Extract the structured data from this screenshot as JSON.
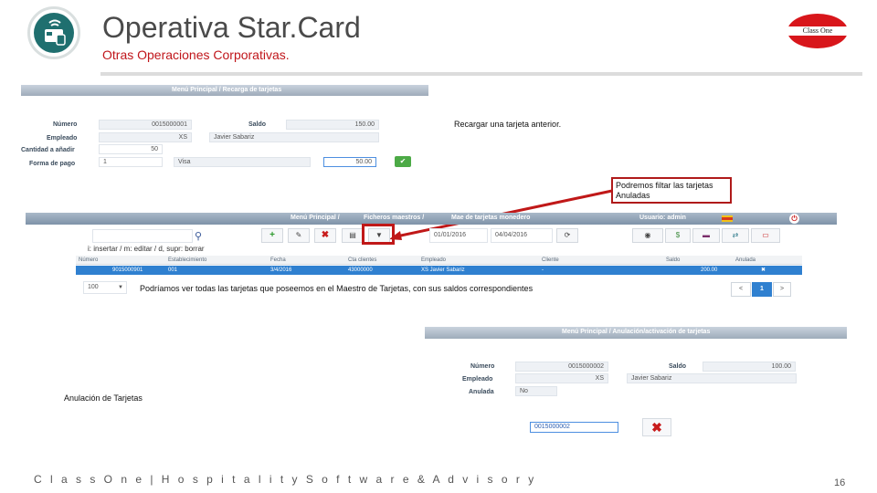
{
  "header": {
    "title": "Operativa Star.Card",
    "subtitle": "Otras Operaciones Corporativas.",
    "brand_logo_text": "Class One"
  },
  "recarga": {
    "breadcrumb": "Menú Principal  /  Recarga de tarjetas",
    "numero_label": "Número",
    "numero_value": "0015000001",
    "saldo_label": "Saldo",
    "saldo_value": "150.00",
    "empleado_label": "Empleado",
    "empleado_code": "XS",
    "empleado_name": "Javier Sabariz",
    "cantidad_label": "Cantidad a añadir",
    "cantidad_value": "50",
    "forma_pago_label": "Forma de pago",
    "forma_pago_code": "1",
    "forma_pago_name": "Visa",
    "importe_value": "50.00",
    "ok_icon": "check-icon"
  },
  "notes": {
    "recargar": "Recargar una tarjeta anterior.",
    "filtrar_line1": "Podremos filtar las tarjetas",
    "filtrar_line2": "Anuladas",
    "ver_todas": "Podríamos ver todas las tarjetas que poseemos en el Maestro de Tarjetas, con sus saldos correspondientes",
    "anulacion": "Anulación de Tarjetas"
  },
  "tarjetas": {
    "breadcrumb_menu": "Menú Principal  /",
    "breadcrumb_maestros": "Ficheros maestros  /",
    "breadcrumb_tail": "Mae      de tarjetas monedero",
    "usuario": "Usuario: admin",
    "date_from": "01/01/2016",
    "date_to": "04/04/2016",
    "help": "i: insertar / m: editar / d, supr: borrar",
    "columns": [
      "Número",
      "Establecimiento",
      "Fecha",
      "Cta clientes",
      "Empleado",
      "Cliente",
      "Saldo",
      "Anulada"
    ],
    "row": {
      "numero": "9015000901",
      "establecimiento": "001",
      "fecha": "3/4/2016",
      "cta": "43000000",
      "empleado": "XS   Javier Sabariz",
      "cliente": "-",
      "saldo": "200.00",
      "anulada": "✖"
    },
    "page_size": "100",
    "pages": [
      "<",
      "1",
      ">"
    ]
  },
  "anulacion": {
    "breadcrumb": "Menú Principal  /  Anulación/activación de tarjetas",
    "numero_label": "Número",
    "numero_value": "0015000002",
    "saldo_label": "Saldo",
    "saldo_value": "100.00",
    "empleado_label": "Empleado",
    "empleado_code": "XS",
    "empleado_name": "Javier Sabariz",
    "anulada_label": "Anulada",
    "anulada_value": "No",
    "input_value": "0015000002"
  },
  "footer": {
    "text": "C l a s s O n e | H o s p i t a l i t y S o f t w a r e & A d v i s o r y",
    "page": "16"
  },
  "colors": {
    "accent_red": "#c0161b",
    "table_selected": "#2f80d0",
    "logo_teal": "#1f6f6f"
  }
}
